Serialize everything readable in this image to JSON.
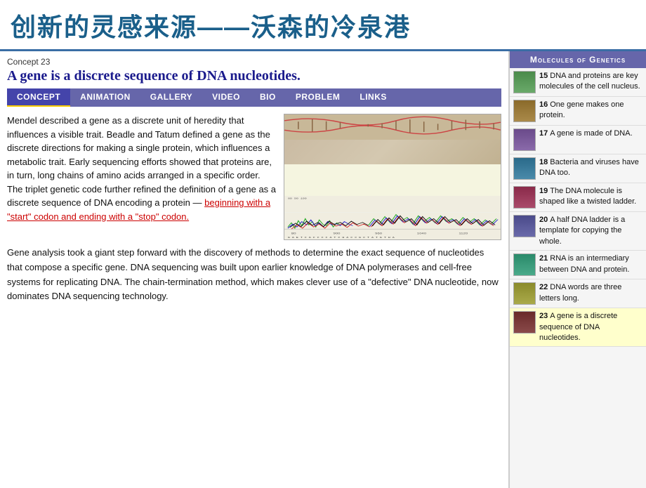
{
  "title": {
    "text": "创新的灵感来源——沃森的冷泉港"
  },
  "concept": {
    "label": "Concept 23",
    "title": "A gene is a discrete sequence of DNA nucleotides.",
    "tabs": [
      {
        "id": "concept",
        "label": "Concept",
        "active": true
      },
      {
        "id": "animation",
        "label": "Animation",
        "active": false
      },
      {
        "id": "gallery",
        "label": "Gallery",
        "active": false
      },
      {
        "id": "video",
        "label": "Video",
        "active": false
      },
      {
        "id": "bio",
        "label": "Bio",
        "active": false
      },
      {
        "id": "problem",
        "label": "Problem",
        "active": false
      },
      {
        "id": "links",
        "label": "Links",
        "active": false
      }
    ],
    "paragraph1_normal": "Mendel described a gene as a discrete unit of heredity that influences a visible trait. Beadle and Tatum defined a gene as the discrete directions for making a single protein, which influences a metabolic trait. Early sequencing efforts showed that proteins are, in turn, long chains of amino acids arranged in a specific order. The triplet genetic code further refined the definition of a gene as a discrete sequence of DNA encoding a protein —",
    "paragraph1_highlight": "beginning with a \"start\" codon and ending with a \"stop\" codon.",
    "paragraph2": "Gene analysis took a giant step forward with the discovery of methods to determine the exact sequence of nucleotides that compose a specific gene. DNA sequencing was built upon earlier knowledge of DNA polymerases and cell-free systems for replicating DNA. The chain-termination method, which makes clever use of a \"defective\" DNA nucleotide, now dominates DNA sequencing technology."
  },
  "sidebar": {
    "title": "Molecules of Genetics",
    "items": [
      {
        "num": "15",
        "text": "DNA and proteins are key molecules of the cell nucleus.",
        "active": false
      },
      {
        "num": "16",
        "text": "One gene makes one protein.",
        "active": false
      },
      {
        "num": "17",
        "text": "A gene is made of DNA.",
        "active": false
      },
      {
        "num": "18",
        "text": "Bacteria and viruses have DNA too.",
        "active": false
      },
      {
        "num": "19",
        "text": "The DNA molecule is shaped like a twisted ladder.",
        "active": false
      },
      {
        "num": "20",
        "text": "A half DNA ladder is a template for copying the whole.",
        "active": false
      },
      {
        "num": "21",
        "text": "RNA is an intermediary between DNA and protein.",
        "active": false
      },
      {
        "num": "22",
        "text": "DNA words are three letters long.",
        "active": false
      },
      {
        "num": "23",
        "text": "A gene is a discrete sequence of DNA nucleotides.",
        "active": true
      }
    ]
  }
}
